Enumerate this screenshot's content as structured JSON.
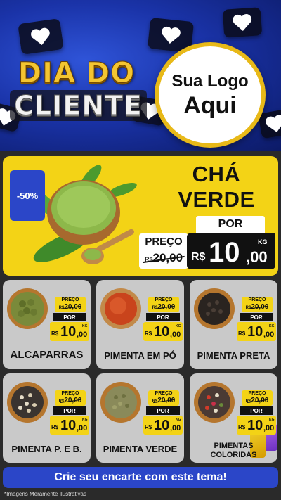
{
  "banner": {
    "title_line1": "DIA DO",
    "title_line2": "CLIENTE",
    "logo_line1": "Sua Logo",
    "logo_line2": "Aqui"
  },
  "hero": {
    "discount": "-50%",
    "name_line1": "CHÁ",
    "name_line2": "VERDE",
    "preco_label": "PREÇO",
    "old_currency": "R$",
    "old_price": "20,00",
    "por_label": "POR",
    "currency": "R$",
    "price_int": "10",
    "price_dec": ",00",
    "unit": "KG"
  },
  "products": [
    {
      "name": "ALCAPARRAS",
      "preco_label": "PREÇO",
      "old_currency": "R$",
      "old_price": "20,00",
      "por_label": "POR",
      "currency": "R$",
      "price_int": "10",
      "price_dec": ",00",
      "unit": "KG"
    },
    {
      "name": "PIMENTA EM PÓ",
      "preco_label": "PREÇO",
      "old_currency": "R$",
      "old_price": "20,00",
      "por_label": "POR",
      "currency": "R$",
      "price_int": "10",
      "price_dec": ",00",
      "unit": "KG"
    },
    {
      "name": "PIMENTA PRETA",
      "preco_label": "PREÇO",
      "old_currency": "R$",
      "old_price": "20,00",
      "por_label": "POR",
      "currency": "R$",
      "price_int": "10",
      "price_dec": ",00",
      "unit": "KG"
    },
    {
      "name": "PIMENTA P. E B.",
      "preco_label": "PREÇO",
      "old_currency": "R$",
      "old_price": "20,00",
      "por_label": "POR",
      "currency": "R$",
      "price_int": "10",
      "price_dec": ",00",
      "unit": "KG"
    },
    {
      "name": "PIMENTA VERDE",
      "preco_label": "PREÇO",
      "old_currency": "R$",
      "old_price": "20,00",
      "por_label": "POR",
      "currency": "R$",
      "price_int": "10",
      "price_dec": ",00",
      "unit": "KG"
    },
    {
      "name_line1": "PIMENTAS",
      "name_line2": "COLORIDAS",
      "preco_label": "PREÇO",
      "old_currency": "R$",
      "old_price": "20,00",
      "por_label": "POR",
      "currency": "R$",
      "price_int": "10",
      "price_dec": ",00",
      "unit": "KG"
    }
  ],
  "cta": "Crie seu encarte com este tema!",
  "footnote": "*Imagens Meramente Ilustrativas",
  "colors": {
    "banner_blue": "#1a33a8",
    "yellow": "#f3d316",
    "gold": "#e8b918",
    "card_gray": "#c9c9c9",
    "cta_blue": "#2b46c8",
    "dark": "#111111"
  },
  "icons": [
    "heart-icon",
    "shopping-bag-icon"
  ]
}
